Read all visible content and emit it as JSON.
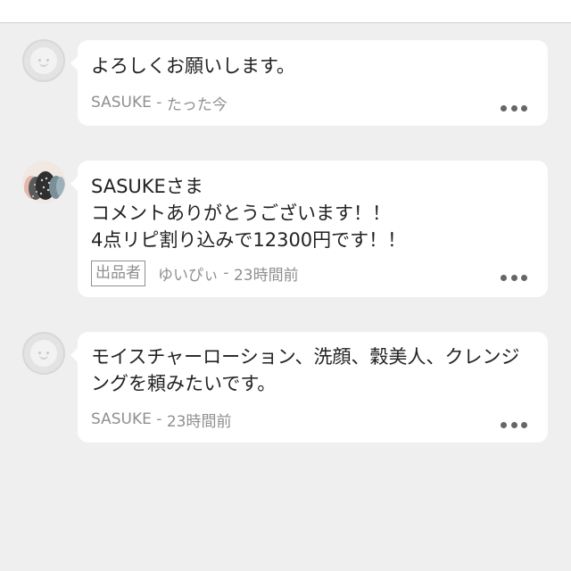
{
  "comments": [
    {
      "avatar": "default-avatar",
      "text": "よろしくお願いします。",
      "author": "SASUKE",
      "separator": " - ",
      "time": "たった今",
      "more_icon": "more-dots-icon"
    },
    {
      "avatar": "user-photo-avatar",
      "text": "SASUKEさま\nコメントありがとうございます！！\n4点リピ割り込みで12300円です！！",
      "badge": "出品者",
      "author": "ゆいぴぃ",
      "separator": " - ",
      "time": "23時間前",
      "more_icon": "more-dots-icon"
    },
    {
      "avatar": "default-avatar",
      "text": "モイスチャーローション、洗顔、穀美人、クレンジングを頼みたいです。",
      "author": "SASUKE",
      "separator": " - ",
      "time": "23時間前",
      "more_icon": "more-dots-icon"
    }
  ],
  "colors": {
    "background": "#efefef",
    "bubble": "#ffffff",
    "text": "#222222",
    "meta": "#8f8f8f"
  }
}
